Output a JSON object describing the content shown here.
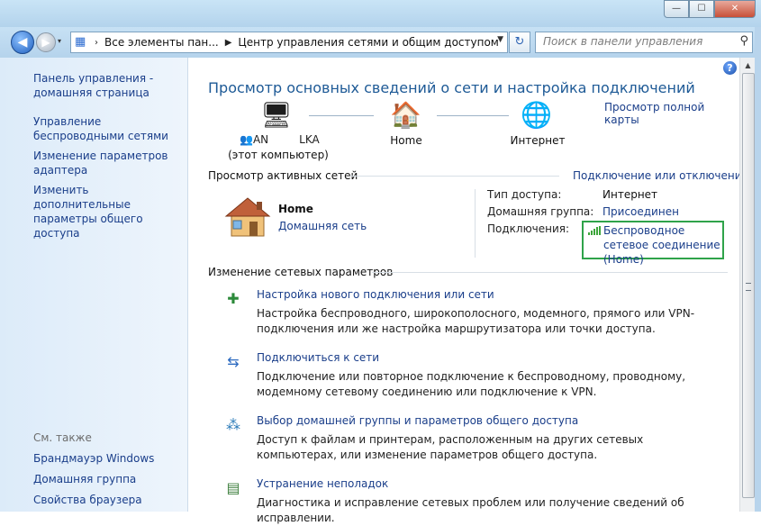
{
  "window": {
    "controls": {
      "minimize": "—",
      "maximize": "☐",
      "close": "✕"
    }
  },
  "navbar": {
    "back": "◀",
    "forward": "▶",
    "recent": "▾",
    "address": {
      "icon": "control-panel-icon",
      "seg1": "Все элементы пан...",
      "seg2": "Центр управления сетями и общим доступом"
    },
    "search_placeholder": "Поиск в панели управления"
  },
  "sidebar": {
    "home_link": "Панель управления - домашняя страница",
    "links": [
      "Управление беспроводными сетями",
      "Изменение параметров адаптера",
      "Изменить дополнительные параметры общего доступа"
    ],
    "see_also": "См. также",
    "see_also_links": [
      "Брандмауэр Windows",
      "Домашняя группа",
      "Свойства браузера"
    ]
  },
  "main": {
    "title": "Просмотр основных сведений о сети и настройка подключений",
    "full_map": "Просмотр полной карты",
    "map": {
      "computer_name": "AN",
      "computer_name_tail": "LKA",
      "computer_sub": "(этот компьютер)",
      "home": "Home",
      "internet": "Интернет"
    },
    "active_header": "Просмотр активных сетей",
    "connect_link": "Подключение или отключение",
    "network": {
      "name": "Home",
      "type": "Домашняя сеть"
    },
    "props": {
      "access_key": "Тип доступа:",
      "access_val": "Интернет",
      "homegroup_key": "Домашняя группа:",
      "homegroup_val": "Присоединен",
      "conn_key": "Подключения:",
      "conn_val": "Беспроводное сетевое соединение (Home)"
    },
    "change_header": "Изменение сетевых параметров",
    "tasks": [
      {
        "title": "Настройка нового подключения или сети",
        "desc": "Настройка беспроводного, широкополосного, модемного, прямого или VPN-подключения или же настройка маршрутизатора или точки доступа."
      },
      {
        "title": "Подключиться к сети",
        "desc": "Подключение или повторное подключение к беспроводному, проводному, модемному сетевому соединению или подключение к VPN."
      },
      {
        "title": "Выбор домашней группы и параметров общего доступа",
        "desc": "Доступ к файлам и принтерам, расположенным на других сетевых компьютерах, или изменение параметров общего доступа."
      },
      {
        "title": "Устранение неполадок",
        "desc": "Диагностика и исправление сетевых проблем или получение сведений об исправлении."
      }
    ]
  },
  "icons": {
    "help": "?",
    "search": "⚲",
    "refresh": "↻"
  }
}
